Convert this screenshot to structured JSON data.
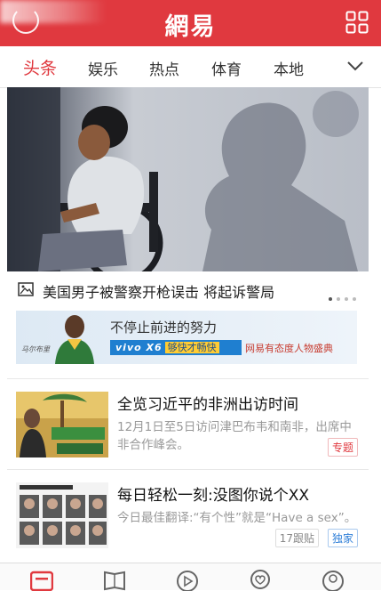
{
  "header": {
    "logo": "網易",
    "accent_color": "#e0393f",
    "left_icon": "user-avatar-icon",
    "right_icon": "grid-menu-icon"
  },
  "tabs": {
    "items": [
      {
        "label": "头条",
        "active": true
      },
      {
        "label": "娱乐",
        "active": false
      },
      {
        "label": "热点",
        "active": false
      },
      {
        "label": "体育",
        "active": false
      },
      {
        "label": "本地",
        "active": false
      }
    ],
    "more_icon": "chevron-down-icon"
  },
  "hero": {
    "title": "美国男子被警察开枪误击 将起诉警局",
    "icon": "picture-icon",
    "slide_count": 4,
    "current_slide": 1
  },
  "ad": {
    "slogan": "不停止前进的努力",
    "brand": "vivo X6",
    "tagline": "够快才畅快",
    "event": "网易有态度人物盛典",
    "signature": "马尔布里"
  },
  "news": [
    {
      "title": "全览习近平的非洲出访时间",
      "digest": "12月1日至5日访问津巴布韦和南非，出席中非合作峰会。",
      "badge": "专题",
      "badge_color": "#e0393f"
    },
    {
      "title": "每日轻松一刻:没图你说个XX",
      "digest": "今日最佳翻译:“有个性”就是“Have a sex”。",
      "replies": "17跟贴",
      "badge": "独家",
      "badge_color": "#2f7fd8"
    }
  ],
  "bottom_nav": {
    "icons": [
      "news-tab-icon",
      "reading-tab-icon",
      "video-tab-icon",
      "topic-tab-icon",
      "me-tab-icon"
    ]
  }
}
